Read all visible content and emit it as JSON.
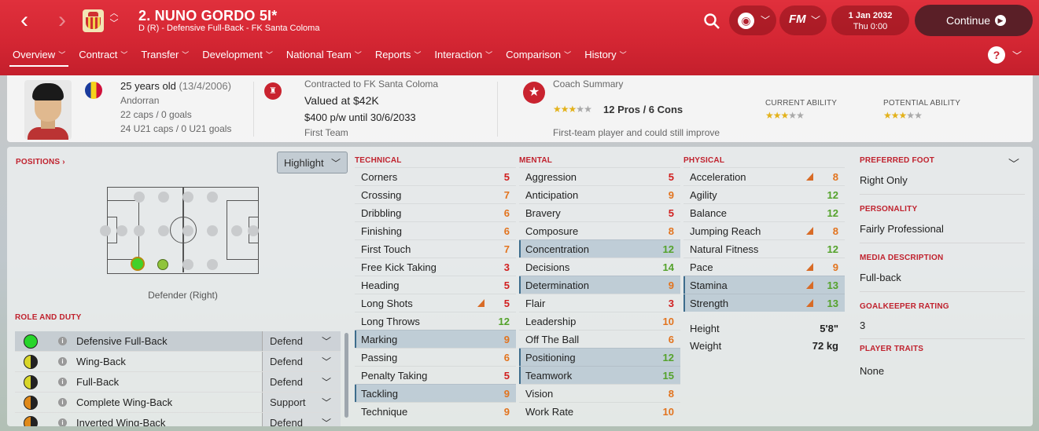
{
  "header": {
    "name": "2. NUNO GORDO 5I*",
    "subtitle": "D (R) - Defensive Full-Back - FK Santa Coloma",
    "date": "1 Jan 2032",
    "time": "Thu 0:00",
    "continue": "Continue",
    "fm": "FM",
    "help": "?"
  },
  "tabs": [
    "Overview",
    "Contract",
    "Transfer",
    "Development",
    "National Team",
    "Reports",
    "Interaction",
    "Comparison",
    "History"
  ],
  "summary": {
    "age": "25 years old",
    "dob": "(13/4/2006)",
    "nationality": "Andorran",
    "caps": "22 caps / 0 goals",
    "u21caps": "24 U21 caps / 0 U21 goals",
    "contracted": "Contracted to FK Santa Coloma",
    "value": "Valued at $42K",
    "wage": "$400 p/w until 30/6/2033",
    "squad": "First Team",
    "coach_title": "Coach Summary",
    "pros_cons": "12 Pros / 6 Cons",
    "coach_stars": 3,
    "verdict": "First-team player and could still improve",
    "ca_label": "CURRENT ABILITY",
    "pa_label": "POTENTIAL ABILITY",
    "ca_stars": 3,
    "pa_stars": 3
  },
  "positions": {
    "title": "POSITIONS",
    "highlight": "Highlight",
    "label": "Defender (Right)"
  },
  "roles": {
    "title": "ROLE AND DUTY",
    "items": [
      {
        "name": "Defensive Full-Back",
        "duty": "Defend",
        "color": "#27d52b"
      },
      {
        "name": "Wing-Back",
        "duty": "Defend",
        "color": "#d8d62a"
      },
      {
        "name": "Full-Back",
        "duty": "Defend",
        "color": "#d8d62a"
      },
      {
        "name": "Complete Wing-Back",
        "duty": "Support",
        "color": "#e08a1a"
      },
      {
        "name": "Inverted Wing-Back",
        "duty": "Defend",
        "color": "#e08a1a"
      }
    ]
  },
  "technical": {
    "title": "TECHNICAL",
    "items": [
      {
        "n": "Corners",
        "v": "5"
      },
      {
        "n": "Crossing",
        "v": "7"
      },
      {
        "n": "Dribbling",
        "v": "6"
      },
      {
        "n": "Finishing",
        "v": "6"
      },
      {
        "n": "First Touch",
        "v": "7"
      },
      {
        "n": "Free Kick Taking",
        "v": "3"
      },
      {
        "n": "Heading",
        "v": "5"
      },
      {
        "n": "Long Shots",
        "v": "5"
      },
      {
        "n": "Long Throws",
        "v": "12"
      },
      {
        "n": "Marking",
        "v": "9"
      },
      {
        "n": "Passing",
        "v": "6"
      },
      {
        "n": "Penalty Taking",
        "v": "5"
      },
      {
        "n": "Tackling",
        "v": "9"
      },
      {
        "n": "Technique",
        "v": "9"
      }
    ]
  },
  "mental": {
    "title": "MENTAL",
    "items": [
      {
        "n": "Aggression",
        "v": "5"
      },
      {
        "n": "Anticipation",
        "v": "9"
      },
      {
        "n": "Bravery",
        "v": "5"
      },
      {
        "n": "Composure",
        "v": "8"
      },
      {
        "n": "Concentration",
        "v": "12"
      },
      {
        "n": "Decisions",
        "v": "14"
      },
      {
        "n": "Determination",
        "v": "9"
      },
      {
        "n": "Flair",
        "v": "3"
      },
      {
        "n": "Leadership",
        "v": "10"
      },
      {
        "n": "Off The Ball",
        "v": "6"
      },
      {
        "n": "Positioning",
        "v": "12"
      },
      {
        "n": "Teamwork",
        "v": "15"
      },
      {
        "n": "Vision",
        "v": "8"
      },
      {
        "n": "Work Rate",
        "v": "10"
      }
    ]
  },
  "physical": {
    "title": "PHYSICAL",
    "items": [
      {
        "n": "Acceleration",
        "v": "8"
      },
      {
        "n": "Agility",
        "v": "12"
      },
      {
        "n": "Balance",
        "v": "12"
      },
      {
        "n": "Jumping Reach",
        "v": "8"
      },
      {
        "n": "Natural Fitness",
        "v": "12"
      },
      {
        "n": "Pace",
        "v": "9"
      },
      {
        "n": "Stamina",
        "v": "13"
      },
      {
        "n": "Strength",
        "v": "13"
      }
    ],
    "height_label": "Height",
    "height": "5'8\"",
    "weight_label": "Weight",
    "weight": "72 kg"
  },
  "info": {
    "foot_label": "PREFERRED FOOT",
    "foot": "Right Only",
    "personality_label": "PERSONALITY",
    "personality": "Fairly Professional",
    "media_label": "MEDIA DESCRIPTION",
    "media": "Full-back",
    "gk_label": "GOALKEEPER RATING",
    "gk": "3",
    "traits_label": "PLAYER TRAITS",
    "traits": "None"
  }
}
